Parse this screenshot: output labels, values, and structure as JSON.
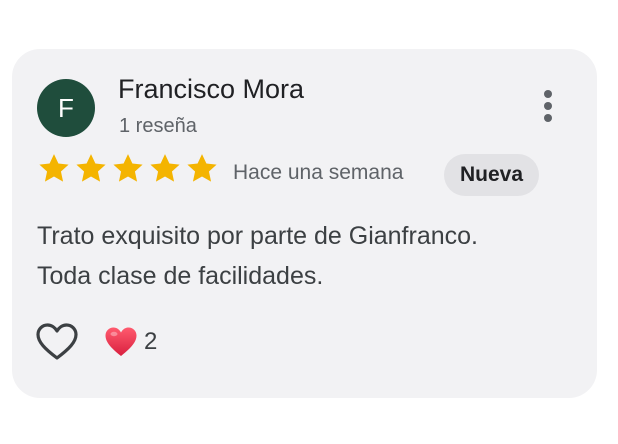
{
  "review": {
    "avatar_initial": "F",
    "avatar_color": "#1f4d3c",
    "author": "Francisco Mora",
    "review_count": "1 reseña",
    "rating": 5,
    "rating_max": 5,
    "star_color": "#f4b400",
    "date": "Hace una semana",
    "badge": "Nueva",
    "text_line1": "Trato exquisito por parte de Gianfranco.",
    "text_line2": "Toda clase de facilidades.",
    "reaction_icon": "red-heart-icon",
    "reaction_count": "2"
  },
  "icons": {
    "more": "more-vert-icon",
    "like": "heart-outline-icon"
  }
}
